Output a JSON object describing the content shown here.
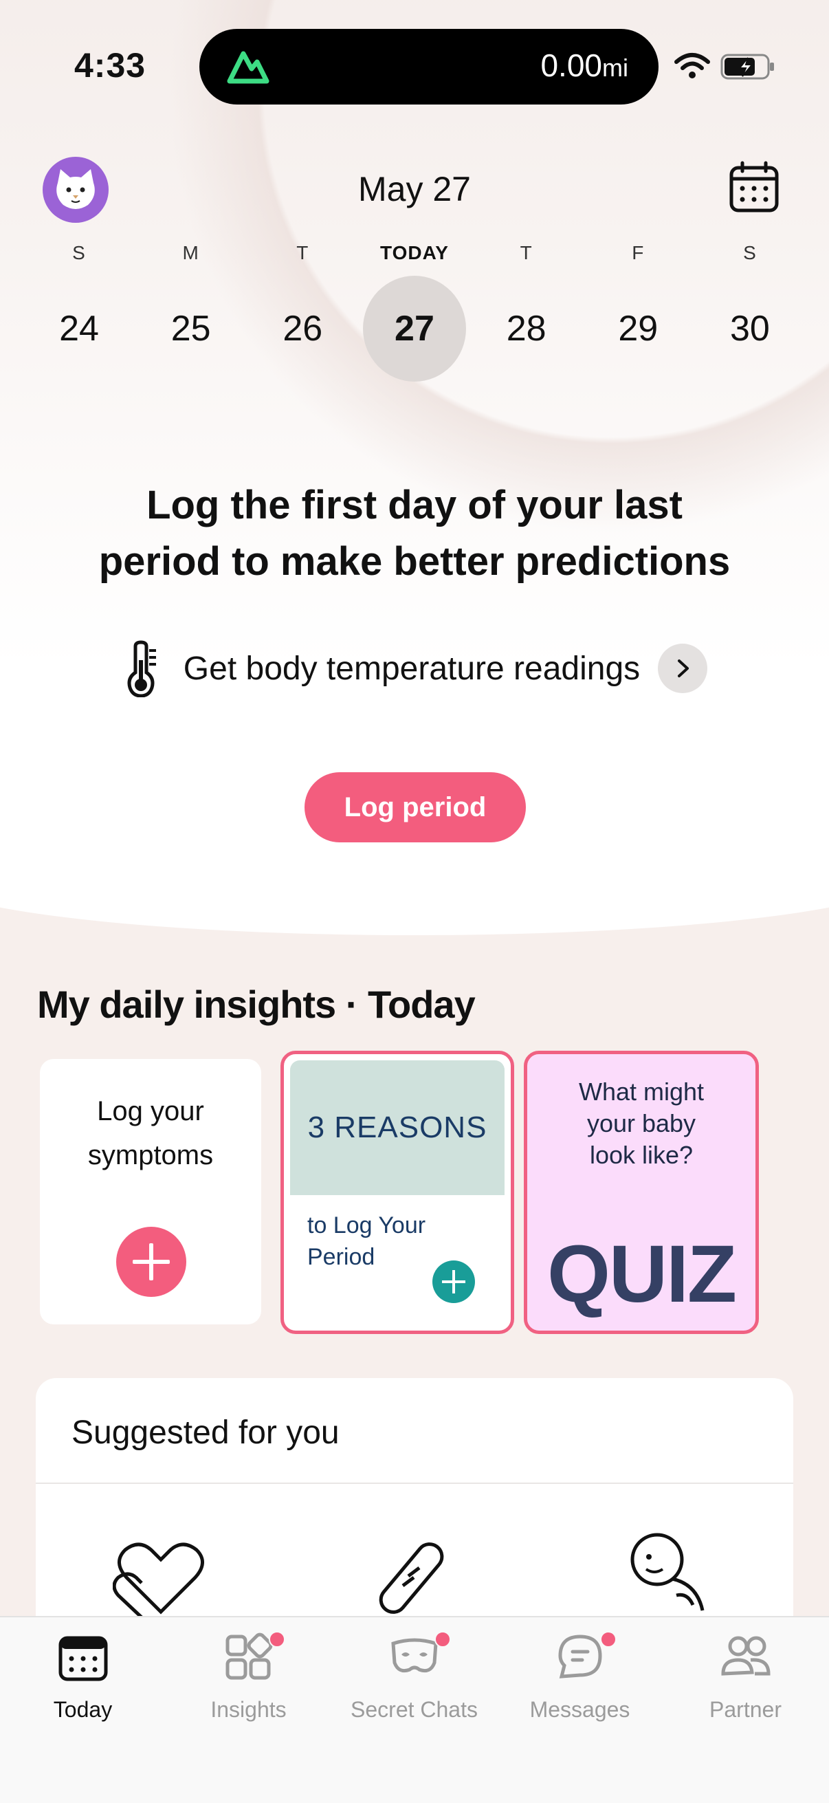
{
  "status_bar": {
    "time": "4:33",
    "distance": "0.00",
    "distance_unit": "mi"
  },
  "header": {
    "date_title": "May 27"
  },
  "week": {
    "days": [
      {
        "weekday": "S",
        "date": "24",
        "is_today": false
      },
      {
        "weekday": "M",
        "date": "25",
        "is_today": false
      },
      {
        "weekday": "T",
        "date": "26",
        "is_today": false
      },
      {
        "weekday": "TODAY",
        "date": "27",
        "is_today": true
      },
      {
        "weekday": "T",
        "date": "28",
        "is_today": false
      },
      {
        "weekday": "F",
        "date": "29",
        "is_today": false
      },
      {
        "weekday": "S",
        "date": "30",
        "is_today": false
      }
    ]
  },
  "hero": {
    "headline_line1": "Log the first day of your last",
    "headline_line2": "period to make better predictions",
    "temperature_link": "Get body temperature readings",
    "log_button": "Log period"
  },
  "insights": {
    "title": "My daily insights · Today",
    "card1_line1": "Log your",
    "card1_line2": "symptoms",
    "card2_top": "3 REASONS",
    "card2_line1": "to Log Your",
    "card2_line2": "Period",
    "card3_line1": "What might",
    "card3_line2": "your baby",
    "card3_line3": "look like?",
    "card3_big": "QUIZ"
  },
  "suggested": {
    "title": "Suggested for you"
  },
  "tabbar": {
    "tabs": [
      {
        "label": "Today",
        "active": true,
        "badge": false
      },
      {
        "label": "Insights",
        "active": false,
        "badge": true
      },
      {
        "label": "Secret Chats",
        "active": false,
        "badge": true
      },
      {
        "label": "Messages",
        "active": false,
        "badge": true
      },
      {
        "label": "Partner",
        "active": false,
        "badge": false
      }
    ]
  },
  "colors": {
    "accent_pink": "#f35d7e",
    "avatar_purple": "#9b63d6",
    "teal": "#199d98",
    "quiz_bg": "#fbdcfb"
  }
}
